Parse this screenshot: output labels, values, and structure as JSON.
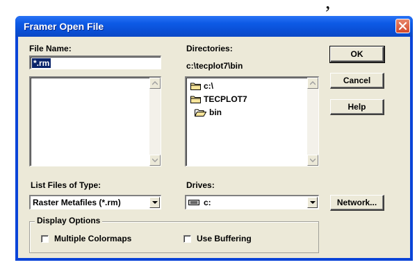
{
  "background_fragment": ", ",
  "window": {
    "title": "Framer Open File"
  },
  "file_name": {
    "label": "File Name:",
    "value": "*.rm",
    "files": []
  },
  "directories": {
    "label": "Directories:",
    "path": "c:\\tecplot7\\bin",
    "items": [
      {
        "label": "c:\\",
        "icon": "folder-closed-icon"
      },
      {
        "label": "TECPLOT7",
        "icon": "folder-closed-icon"
      },
      {
        "label": "bin",
        "icon": "folder-open-icon"
      }
    ]
  },
  "buttons": {
    "ok": "OK",
    "cancel": "Cancel",
    "help": "Help",
    "network": "Network..."
  },
  "file_type": {
    "label": "List Files of Type:",
    "selected": "Raster Metafiles (*.rm)"
  },
  "drives": {
    "label": "Drives:",
    "selected": "c:",
    "icon": "drive-icon"
  },
  "display_options": {
    "label": "Display Options",
    "multiple_colormaps": {
      "label": "Multiple Colormaps",
      "checked": false
    },
    "use_buffering": {
      "label": "Use Buffering",
      "checked": false
    }
  },
  "colors": {
    "titlebar": "#0a4fd6",
    "dialog": "#ece9d8",
    "selection": "#0a246a",
    "close": "#d4482a"
  }
}
